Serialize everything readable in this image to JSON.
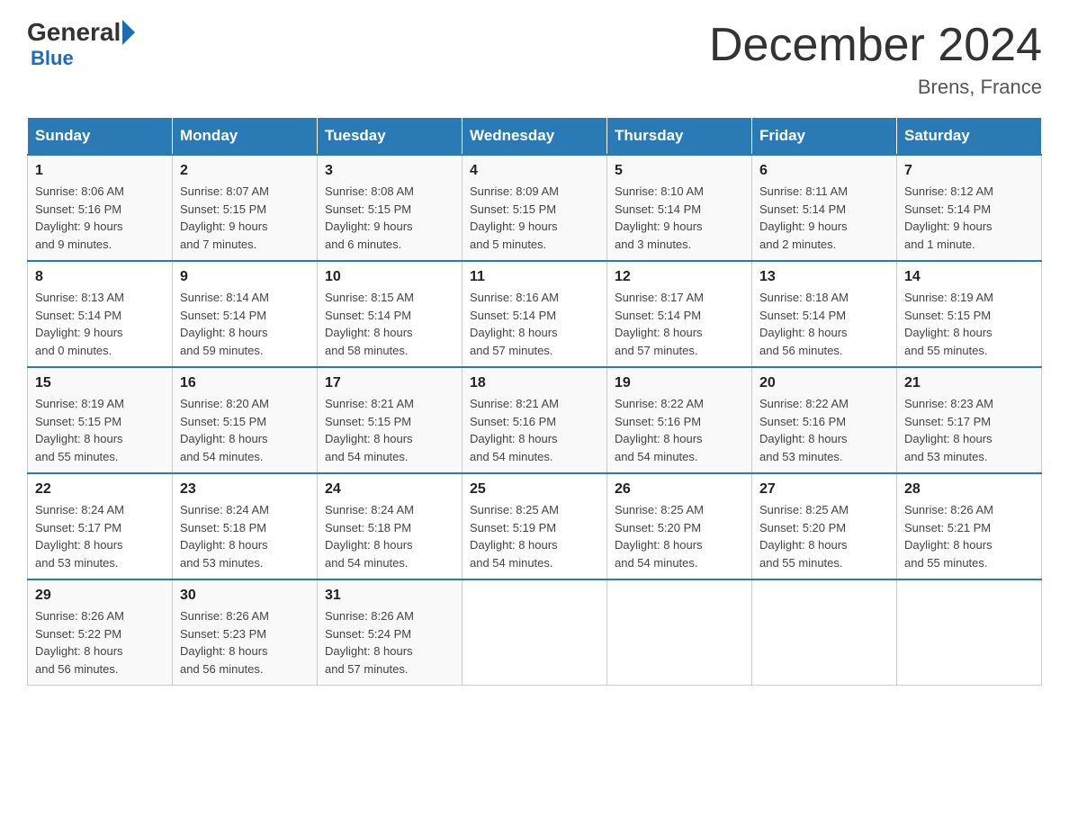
{
  "header": {
    "logo_general": "General",
    "logo_blue": "Blue",
    "month_title": "December 2024",
    "location": "Brens, France"
  },
  "days_of_week": [
    "Sunday",
    "Monday",
    "Tuesday",
    "Wednesday",
    "Thursday",
    "Friday",
    "Saturday"
  ],
  "weeks": [
    [
      {
        "day": "1",
        "sunrise": "8:06 AM",
        "sunset": "5:16 PM",
        "daylight": "9 hours and 9 minutes."
      },
      {
        "day": "2",
        "sunrise": "8:07 AM",
        "sunset": "5:15 PM",
        "daylight": "9 hours and 7 minutes."
      },
      {
        "day": "3",
        "sunrise": "8:08 AM",
        "sunset": "5:15 PM",
        "daylight": "9 hours and 6 minutes."
      },
      {
        "day": "4",
        "sunrise": "8:09 AM",
        "sunset": "5:15 PM",
        "daylight": "9 hours and 5 minutes."
      },
      {
        "day": "5",
        "sunrise": "8:10 AM",
        "sunset": "5:14 PM",
        "daylight": "9 hours and 3 minutes."
      },
      {
        "day": "6",
        "sunrise": "8:11 AM",
        "sunset": "5:14 PM",
        "daylight": "9 hours and 2 minutes."
      },
      {
        "day": "7",
        "sunrise": "8:12 AM",
        "sunset": "5:14 PM",
        "daylight": "9 hours and 1 minute."
      }
    ],
    [
      {
        "day": "8",
        "sunrise": "8:13 AM",
        "sunset": "5:14 PM",
        "daylight": "9 hours and 0 minutes."
      },
      {
        "day": "9",
        "sunrise": "8:14 AM",
        "sunset": "5:14 PM",
        "daylight": "8 hours and 59 minutes."
      },
      {
        "day": "10",
        "sunrise": "8:15 AM",
        "sunset": "5:14 PM",
        "daylight": "8 hours and 58 minutes."
      },
      {
        "day": "11",
        "sunrise": "8:16 AM",
        "sunset": "5:14 PM",
        "daylight": "8 hours and 57 minutes."
      },
      {
        "day": "12",
        "sunrise": "8:17 AM",
        "sunset": "5:14 PM",
        "daylight": "8 hours and 57 minutes."
      },
      {
        "day": "13",
        "sunrise": "8:18 AM",
        "sunset": "5:14 PM",
        "daylight": "8 hours and 56 minutes."
      },
      {
        "day": "14",
        "sunrise": "8:19 AM",
        "sunset": "5:15 PM",
        "daylight": "8 hours and 55 minutes."
      }
    ],
    [
      {
        "day": "15",
        "sunrise": "8:19 AM",
        "sunset": "5:15 PM",
        "daylight": "8 hours and 55 minutes."
      },
      {
        "day": "16",
        "sunrise": "8:20 AM",
        "sunset": "5:15 PM",
        "daylight": "8 hours and 54 minutes."
      },
      {
        "day": "17",
        "sunrise": "8:21 AM",
        "sunset": "5:15 PM",
        "daylight": "8 hours and 54 minutes."
      },
      {
        "day": "18",
        "sunrise": "8:21 AM",
        "sunset": "5:16 PM",
        "daylight": "8 hours and 54 minutes."
      },
      {
        "day": "19",
        "sunrise": "8:22 AM",
        "sunset": "5:16 PM",
        "daylight": "8 hours and 54 minutes."
      },
      {
        "day": "20",
        "sunrise": "8:22 AM",
        "sunset": "5:16 PM",
        "daylight": "8 hours and 53 minutes."
      },
      {
        "day": "21",
        "sunrise": "8:23 AM",
        "sunset": "5:17 PM",
        "daylight": "8 hours and 53 minutes."
      }
    ],
    [
      {
        "day": "22",
        "sunrise": "8:24 AM",
        "sunset": "5:17 PM",
        "daylight": "8 hours and 53 minutes."
      },
      {
        "day": "23",
        "sunrise": "8:24 AM",
        "sunset": "5:18 PM",
        "daylight": "8 hours and 53 minutes."
      },
      {
        "day": "24",
        "sunrise": "8:24 AM",
        "sunset": "5:18 PM",
        "daylight": "8 hours and 54 minutes."
      },
      {
        "day": "25",
        "sunrise": "8:25 AM",
        "sunset": "5:19 PM",
        "daylight": "8 hours and 54 minutes."
      },
      {
        "day": "26",
        "sunrise": "8:25 AM",
        "sunset": "5:20 PM",
        "daylight": "8 hours and 54 minutes."
      },
      {
        "day": "27",
        "sunrise": "8:25 AM",
        "sunset": "5:20 PM",
        "daylight": "8 hours and 55 minutes."
      },
      {
        "day": "28",
        "sunrise": "8:26 AM",
        "sunset": "5:21 PM",
        "daylight": "8 hours and 55 minutes."
      }
    ],
    [
      {
        "day": "29",
        "sunrise": "8:26 AM",
        "sunset": "5:22 PM",
        "daylight": "8 hours and 56 minutes."
      },
      {
        "day": "30",
        "sunrise": "8:26 AM",
        "sunset": "5:23 PM",
        "daylight": "8 hours and 56 minutes."
      },
      {
        "day": "31",
        "sunrise": "8:26 AM",
        "sunset": "5:24 PM",
        "daylight": "8 hours and 57 minutes."
      },
      null,
      null,
      null,
      null
    ]
  ],
  "labels": {
    "sunrise": "Sunrise:",
    "sunset": "Sunset:",
    "daylight": "Daylight:"
  }
}
